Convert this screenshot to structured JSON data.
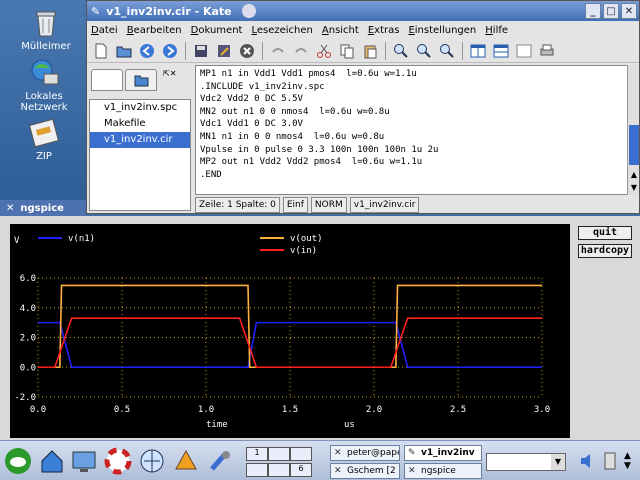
{
  "desktop": {
    "icons": [
      {
        "label": "Mülleimer",
        "icon": "trash-icon"
      },
      {
        "label": "Lokales Netzwerk",
        "icon": "network-icon"
      },
      {
        "label": "ZIP",
        "icon": "zip-drive-icon"
      }
    ]
  },
  "kate": {
    "title": "v1_inv2inv.cir - Kate",
    "menu": [
      "Datei",
      "Bearbeiten",
      "Dokument",
      "Lesezeichen",
      "Ansicht",
      "Extras",
      "Einstellungen",
      "Hilfe"
    ],
    "files": [
      "v1_inv2inv.spc",
      "Makefile",
      "v1_inv2inv.cir"
    ],
    "code": [
      "MP1 n1 in Vdd1 Vdd1 pmos4  l=0.6u w=1.1u",
      ".INCLUDE v1_inv2inv.spc",
      "Vdc2 Vdd2 0 DC 5.5V",
      "MN2 out n1 0 0 nmos4  l=0.6u w=0.8u",
      "Vdc1 Vdd1 0 DC 3.0V",
      "MN1 n1 in 0 0 nmos4  l=0.6u w=0.8u",
      "Vpulse in 0 pulse 0 3.3 100n 100n 100n 1u 2u",
      "MP2 out n1 Vdd2 Vdd2 pmos4  l=0.6u w=1.1u",
      ".END"
    ],
    "status": {
      "pos": "Zeile: 1 Spalte: 0",
      "mode": "Einf",
      "norm": "NORM",
      "file": "v1_inv2inv.cir"
    }
  },
  "ngspice": {
    "title": "ngspice",
    "buttons": {
      "quit": "quit",
      "hardcopy": "hardcopy"
    }
  },
  "chart_data": {
    "type": "line",
    "title": "",
    "xlabel": "time",
    "xunit": "us",
    "ylabel": "V",
    "xlim": [
      0,
      3.0
    ],
    "ylim": [
      -2.0,
      6.0
    ],
    "xticks": [
      0.0,
      0.5,
      1.0,
      1.5,
      2.0,
      2.5,
      3.0
    ],
    "yticks": [
      -2.0,
      0.0,
      2.0,
      4.0,
      6.0
    ],
    "xtick_labels": [
      "0.0",
      "0.5",
      "1.0",
      "1.5",
      "2.0",
      "2.5",
      "3.0"
    ],
    "ytick_labels": [
      "-2.0",
      "0.0",
      "2.0",
      "4.0",
      "6.0"
    ],
    "grid": true,
    "series": [
      {
        "name": "v(n1)",
        "color": "#2020ff",
        "x": [
          0,
          0.13,
          0.2,
          1.25,
          1.3,
          2.13,
          2.2,
          3.0
        ],
        "y": [
          3.0,
          3.0,
          0.0,
          0.0,
          3.0,
          3.0,
          0.0,
          0.0
        ]
      },
      {
        "name": "v(out)",
        "color": "#ffb040",
        "x": [
          0,
          0.13,
          0.14,
          1.25,
          1.26,
          2.13,
          2.14,
          3.0
        ],
        "y": [
          0.0,
          0.0,
          5.5,
          5.5,
          0.0,
          0.0,
          5.5,
          5.5
        ]
      },
      {
        "name": "v(in)",
        "color": "#ff2020",
        "x": [
          0,
          0.1,
          0.2,
          1.2,
          1.3,
          2.1,
          2.2,
          3.0
        ],
        "y": [
          0.0,
          0.0,
          3.3,
          3.3,
          0.0,
          0.0,
          3.3,
          3.3
        ]
      }
    ]
  },
  "taskbar": {
    "tasks": [
      {
        "label": "peter@pape"
      },
      {
        "label": "v1_inv2inv"
      },
      {
        "label": "Gschem [2"
      },
      {
        "label": "ngspice"
      }
    ],
    "pager": [
      "1",
      "6"
    ]
  }
}
